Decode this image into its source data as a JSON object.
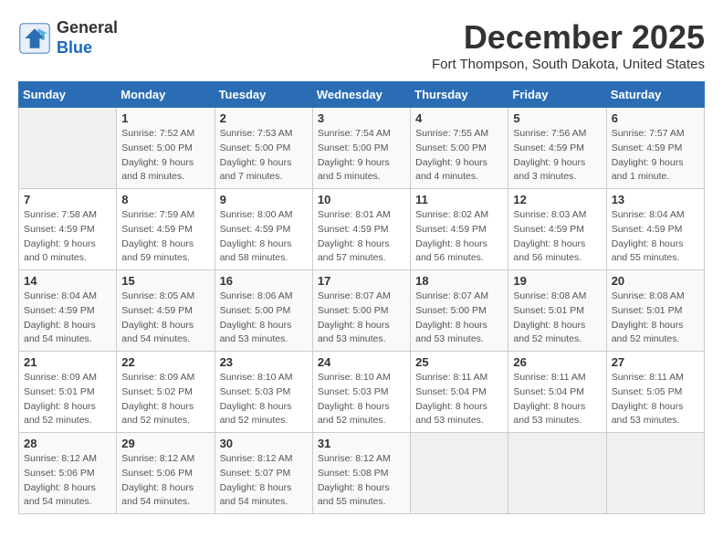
{
  "header": {
    "logo_line1": "General",
    "logo_line2": "Blue",
    "month": "December 2025",
    "location": "Fort Thompson, South Dakota, United States"
  },
  "weekdays": [
    "Sunday",
    "Monday",
    "Tuesday",
    "Wednesday",
    "Thursday",
    "Friday",
    "Saturday"
  ],
  "weeks": [
    [
      {
        "day": "",
        "empty": true
      },
      {
        "day": "1",
        "sunrise": "7:52 AM",
        "sunset": "5:00 PM",
        "daylight": "9 hours and 8 minutes."
      },
      {
        "day": "2",
        "sunrise": "7:53 AM",
        "sunset": "5:00 PM",
        "daylight": "9 hours and 7 minutes."
      },
      {
        "day": "3",
        "sunrise": "7:54 AM",
        "sunset": "5:00 PM",
        "daylight": "9 hours and 5 minutes."
      },
      {
        "day": "4",
        "sunrise": "7:55 AM",
        "sunset": "5:00 PM",
        "daylight": "9 hours and 4 minutes."
      },
      {
        "day": "5",
        "sunrise": "7:56 AM",
        "sunset": "4:59 PM",
        "daylight": "9 hours and 3 minutes."
      },
      {
        "day": "6",
        "sunrise": "7:57 AM",
        "sunset": "4:59 PM",
        "daylight": "9 hours and 1 minute."
      }
    ],
    [
      {
        "day": "7",
        "sunrise": "7:58 AM",
        "sunset": "4:59 PM",
        "daylight": "9 hours and 0 minutes."
      },
      {
        "day": "8",
        "sunrise": "7:59 AM",
        "sunset": "4:59 PM",
        "daylight": "8 hours and 59 minutes."
      },
      {
        "day": "9",
        "sunrise": "8:00 AM",
        "sunset": "4:59 PM",
        "daylight": "8 hours and 58 minutes."
      },
      {
        "day": "10",
        "sunrise": "8:01 AM",
        "sunset": "4:59 PM",
        "daylight": "8 hours and 57 minutes."
      },
      {
        "day": "11",
        "sunrise": "8:02 AM",
        "sunset": "4:59 PM",
        "daylight": "8 hours and 56 minutes."
      },
      {
        "day": "12",
        "sunrise": "8:03 AM",
        "sunset": "4:59 PM",
        "daylight": "8 hours and 56 minutes."
      },
      {
        "day": "13",
        "sunrise": "8:04 AM",
        "sunset": "4:59 PM",
        "daylight": "8 hours and 55 minutes."
      }
    ],
    [
      {
        "day": "14",
        "sunrise": "8:04 AM",
        "sunset": "4:59 PM",
        "daylight": "8 hours and 54 minutes."
      },
      {
        "day": "15",
        "sunrise": "8:05 AM",
        "sunset": "4:59 PM",
        "daylight": "8 hours and 54 minutes."
      },
      {
        "day": "16",
        "sunrise": "8:06 AM",
        "sunset": "5:00 PM",
        "daylight": "8 hours and 53 minutes."
      },
      {
        "day": "17",
        "sunrise": "8:07 AM",
        "sunset": "5:00 PM",
        "daylight": "8 hours and 53 minutes."
      },
      {
        "day": "18",
        "sunrise": "8:07 AM",
        "sunset": "5:00 PM",
        "daylight": "8 hours and 53 minutes."
      },
      {
        "day": "19",
        "sunrise": "8:08 AM",
        "sunset": "5:01 PM",
        "daylight": "8 hours and 52 minutes."
      },
      {
        "day": "20",
        "sunrise": "8:08 AM",
        "sunset": "5:01 PM",
        "daylight": "8 hours and 52 minutes."
      }
    ],
    [
      {
        "day": "21",
        "sunrise": "8:09 AM",
        "sunset": "5:01 PM",
        "daylight": "8 hours and 52 minutes."
      },
      {
        "day": "22",
        "sunrise": "8:09 AM",
        "sunset": "5:02 PM",
        "daylight": "8 hours and 52 minutes."
      },
      {
        "day": "23",
        "sunrise": "8:10 AM",
        "sunset": "5:03 PM",
        "daylight": "8 hours and 52 minutes."
      },
      {
        "day": "24",
        "sunrise": "8:10 AM",
        "sunset": "5:03 PM",
        "daylight": "8 hours and 52 minutes."
      },
      {
        "day": "25",
        "sunrise": "8:11 AM",
        "sunset": "5:04 PM",
        "daylight": "8 hours and 53 minutes."
      },
      {
        "day": "26",
        "sunrise": "8:11 AM",
        "sunset": "5:04 PM",
        "daylight": "8 hours and 53 minutes."
      },
      {
        "day": "27",
        "sunrise": "8:11 AM",
        "sunset": "5:05 PM",
        "daylight": "8 hours and 53 minutes."
      }
    ],
    [
      {
        "day": "28",
        "sunrise": "8:12 AM",
        "sunset": "5:06 PM",
        "daylight": "8 hours and 54 minutes."
      },
      {
        "day": "29",
        "sunrise": "8:12 AM",
        "sunset": "5:06 PM",
        "daylight": "8 hours and 54 minutes."
      },
      {
        "day": "30",
        "sunrise": "8:12 AM",
        "sunset": "5:07 PM",
        "daylight": "8 hours and 54 minutes."
      },
      {
        "day": "31",
        "sunrise": "8:12 AM",
        "sunset": "5:08 PM",
        "daylight": "8 hours and 55 minutes."
      },
      {
        "day": "",
        "empty": true
      },
      {
        "day": "",
        "empty": true
      },
      {
        "day": "",
        "empty": true
      }
    ]
  ]
}
